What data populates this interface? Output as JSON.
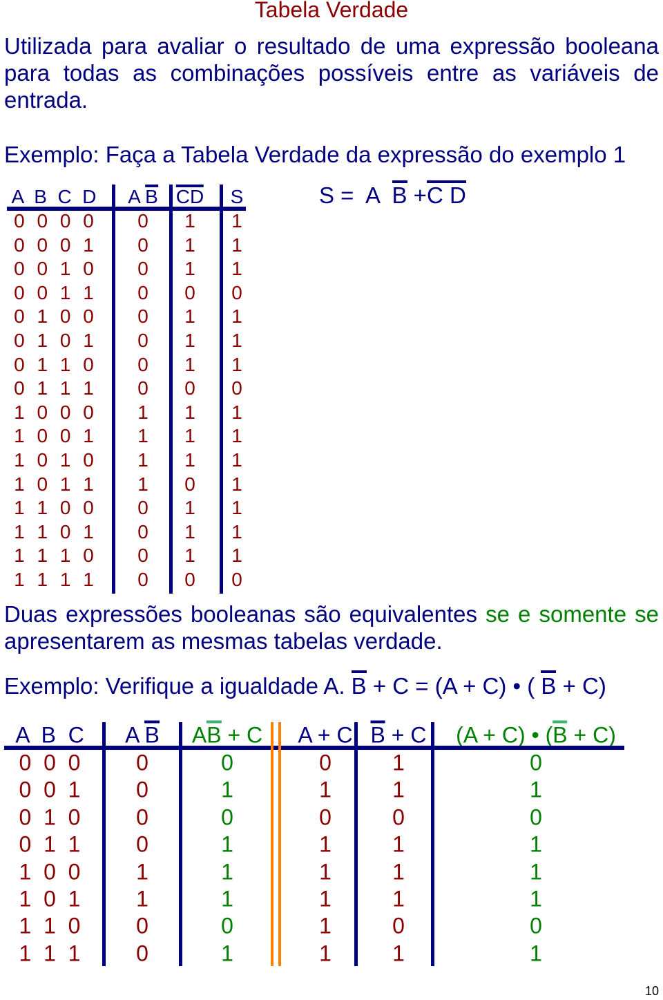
{
  "title": "Tabela Verdade",
  "intro": "Utilizada para avaliar o resultado de uma expressão booleana para todas as combinações possíveis entre as variáveis de entrada.",
  "example1": "Exemplo: Faça a Tabela Verdade da expressão do exemplo 1",
  "table1": {
    "headers": [
      [
        {
          "t": "A  B  C  D"
        }
      ],
      [
        {
          "t": "A "
        },
        {
          "t": "B",
          "bar": true
        }
      ],
      [
        {
          "t": "CD",
          "bar": true
        }
      ],
      [
        {
          "t": "S"
        }
      ]
    ],
    "rows": [
      [
        "0 0 0 0",
        "0",
        "1",
        "1"
      ],
      [
        "0 0 0 1",
        "0",
        "1",
        "1"
      ],
      [
        "0 0 1 0",
        "0",
        "1",
        "1"
      ],
      [
        "0 0 1 1",
        "0",
        "0",
        "0"
      ],
      [
        "0 1 0 0",
        "0",
        "1",
        "1"
      ],
      [
        "0 1 0 1",
        "0",
        "1",
        "1"
      ],
      [
        "0 1 1 0",
        "0",
        "1",
        "1"
      ],
      [
        "0 1 1 1",
        "0",
        "0",
        "0"
      ],
      [
        "1 0 0 0",
        "1",
        "1",
        "1"
      ],
      [
        "1 0 0 1",
        "1",
        "1",
        "1"
      ],
      [
        "1 0 1 0",
        "1",
        "1",
        "1"
      ],
      [
        "1 0 1 1",
        "1",
        "0",
        "1"
      ],
      [
        "1 1 0 0",
        "0",
        "1",
        "1"
      ],
      [
        "1 1 0 1",
        "0",
        "1",
        "1"
      ],
      [
        "1 1 1 0",
        "0",
        "1",
        "1"
      ],
      [
        "1 1 1 1",
        "0",
        "0",
        "0"
      ]
    ]
  },
  "expression1": [
    {
      "t": "S =  A  "
    },
    {
      "t": "B",
      "bar": true
    },
    {
      "t": " +"
    },
    {
      "t": "C D",
      "bar": true
    }
  ],
  "equivalence": [
    {
      "t": "Duas expressões booleanas são equivalentes "
    },
    {
      "t": "se e somente se",
      "green": true
    },
    {
      "t": " apresentarem as mesmas tabelas verdade."
    }
  ],
  "example2": [
    {
      "t": "Exemplo: Verifique a igualdade A. "
    },
    {
      "t": "B",
      "bar": true
    },
    {
      "t": " + C = (A + C) • ( "
    },
    {
      "t": "B",
      "bar": true
    },
    {
      "t": " + C)"
    }
  ],
  "table2": {
    "headers": [
      [
        {
          "t": "A  B  C"
        }
      ],
      [
        {
          "t": "A "
        },
        {
          "t": "B",
          "bar": true
        }
      ],
      [
        {
          "t": "A"
        },
        {
          "t": "B",
          "bar": true
        },
        {
          "t": " + C"
        }
      ],
      [
        {
          "t": "A + C"
        }
      ],
      [
        {
          "t": "B",
          "bar": true
        },
        {
          "t": " + C"
        }
      ],
      [
        {
          "t": "(A + C) • ("
        },
        {
          "t": "B",
          "bar": true
        },
        {
          "t": " + C)"
        }
      ]
    ],
    "green_columns": [
      2,
      5
    ],
    "rows": [
      [
        "0  0  0",
        "0",
        "0",
        "0",
        "1",
        "0"
      ],
      [
        "0  0  1",
        "0",
        "1",
        "1",
        "1",
        "1"
      ],
      [
        "0  1  0",
        "0",
        "0",
        "0",
        "0",
        "0"
      ],
      [
        "0  1  1",
        "0",
        "1",
        "1",
        "1",
        "1"
      ],
      [
        "1  0  0",
        "1",
        "1",
        "1",
        "1",
        "1"
      ],
      [
        "1  0  1",
        "1",
        "1",
        "1",
        "1",
        "1"
      ],
      [
        "1  1  0",
        "0",
        "0",
        "1",
        "0",
        "0"
      ],
      [
        "1  1  1",
        "0",
        "1",
        "1",
        "1",
        "1"
      ]
    ]
  },
  "page_number": "10",
  "colors": {
    "text": "#000080",
    "values": "#8b0000",
    "highlight": "#008000",
    "bar_green": "#3cb371",
    "separator": "#ff7f00"
  }
}
